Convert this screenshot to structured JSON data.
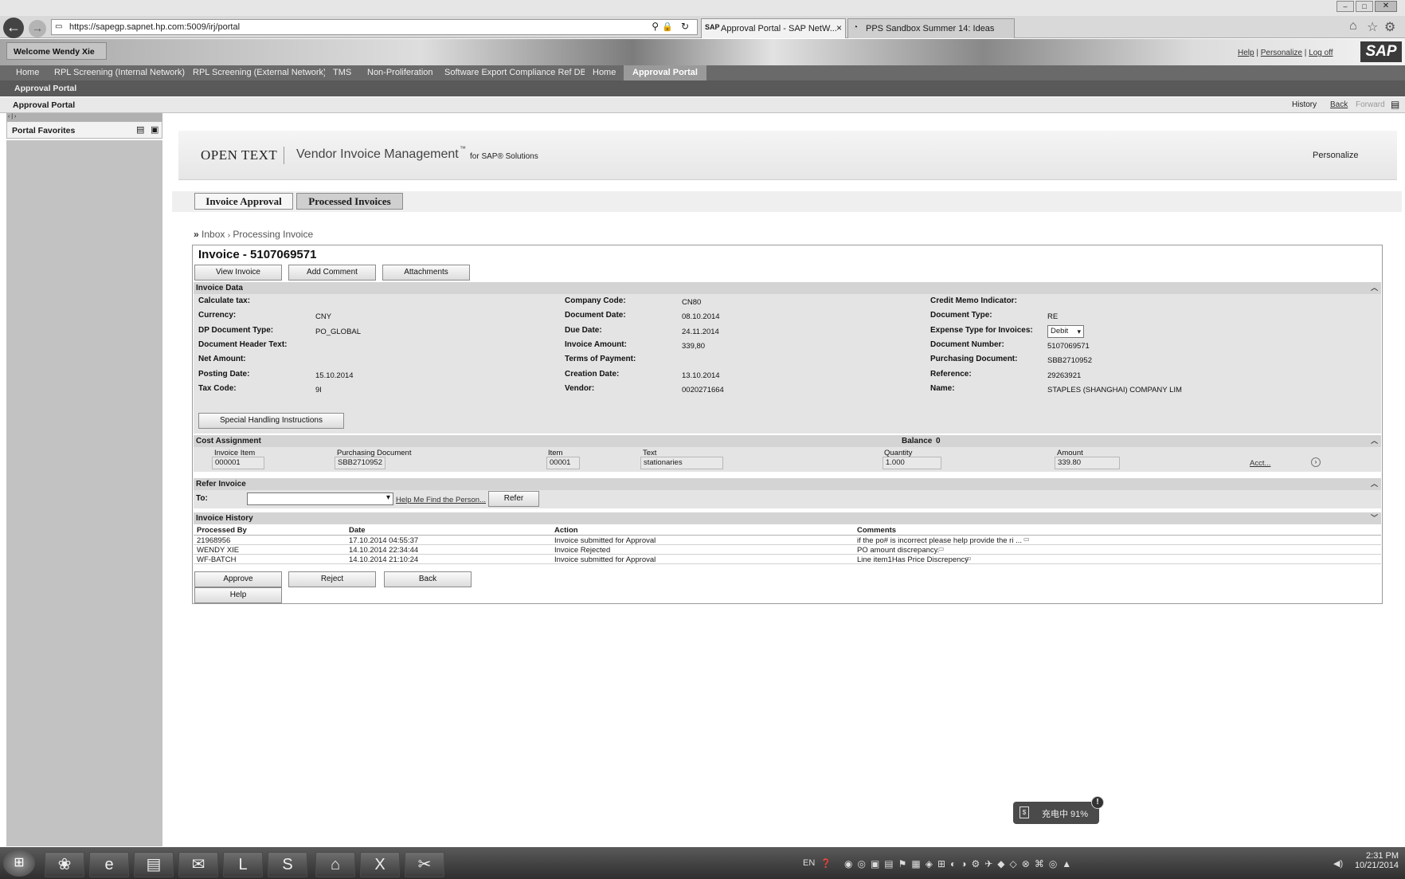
{
  "browser": {
    "url": "https://sapegp.sapnet.hp.com:5009/irj/portal",
    "tabs": [
      {
        "label": "Approval Portal - SAP NetW...",
        "close": "×"
      },
      {
        "label": "PPS Sandbox Summer 14: Ideas"
      }
    ]
  },
  "portal": {
    "welcome": "Welcome Wendy Xie",
    "header_links": [
      "Help",
      "Personalize",
      "Log off"
    ],
    "logo": "SAP",
    "nav_tabs": [
      "Home",
      "RPL Screening (Internal Network)",
      "RPL Screening (External Network)",
      "TMS",
      "Non-Proliferation",
      "Software Export Compliance Ref DB",
      "Home",
      "Approval Portal"
    ],
    "subnav": "Approval Portal",
    "page_title": "Approval Portal",
    "history_links": [
      "History",
      "Back",
      "Forward"
    ],
    "favorites_title": "Portal Favorites"
  },
  "vim": {
    "brand": "OPEN TEXT",
    "product": "Vendor Invoice Management",
    "tm": "™",
    "for_sap": "for SAP® Solutions",
    "personalize": "Personalize",
    "tabs": [
      "Invoice Approval",
      "Processed Invoices"
    ],
    "breadcrumb_root": "Inbox",
    "breadcrumb_sep": "›",
    "breadcrumb_current": "Processing Invoice",
    "invoice_title": "Invoice - 5107069571",
    "action_buttons": [
      "View Invoice",
      "Add Comment",
      "Attachments"
    ]
  },
  "invoice_data": {
    "title": "Invoice Data",
    "col1": [
      {
        "label": "Calculate tax:",
        "value": ""
      },
      {
        "label": "Currency:",
        "value": "CNY"
      },
      {
        "label": "DP Document Type:",
        "value": "PO_GLOBAL"
      },
      {
        "label": "Document Header Text:",
        "value": ""
      },
      {
        "label": "Net Amount:",
        "value": ""
      },
      {
        "label": "Posting Date:",
        "value": "15.10.2014"
      },
      {
        "label": "Tax Code:",
        "value": "9I"
      }
    ],
    "col2": [
      {
        "label": "Company Code:",
        "value": "CN80"
      },
      {
        "label": "Document Date:",
        "value": "08.10.2014"
      },
      {
        "label": "Due Date:",
        "value": "24.11.2014"
      },
      {
        "label": "Invoice Amount:",
        "value": "339,80"
      },
      {
        "label": "Terms of Payment:",
        "value": ""
      },
      {
        "label": "Creation Date:",
        "value": "13.10.2014"
      },
      {
        "label": "Vendor:",
        "value": "0020271664"
      }
    ],
    "col3": [
      {
        "label": "Credit Memo Indicator:",
        "value": ""
      },
      {
        "label": "Document Type:",
        "value": "RE"
      },
      {
        "label": "Expense Type for Invoices:",
        "value": "Debit"
      },
      {
        "label": "Document Number:",
        "value": "5107069571"
      },
      {
        "label": "Purchasing Document:",
        "value": "SBB2710952"
      },
      {
        "label": "Reference:",
        "value": "29263921"
      },
      {
        "label": "Name:",
        "value": "STAPLES (SHANGHAI) COMPANY LIM"
      }
    ],
    "special_button": "Special Handling Instructions"
  },
  "cost_assignment": {
    "title": "Cost Assignment",
    "balance_label": "Balance",
    "balance_value": "0",
    "headers": [
      "Invoice Item",
      "Purchasing Document",
      "Item",
      "Text",
      "Quantity",
      "Amount"
    ],
    "row": [
      "000001",
      "SBB2710952",
      "00001",
      "stationaries",
      "1.000",
      "339.80"
    ],
    "acct_link": "Acct..."
  },
  "refer": {
    "title": "Refer Invoice",
    "to_label": "To:",
    "to_value": "",
    "help_link": "Help Me Find the Person...",
    "refer_button": "Refer"
  },
  "history": {
    "title": "Invoice History",
    "headers": [
      "Processed By",
      "Date",
      "Action",
      "Comments"
    ],
    "rows": [
      [
        "21968956",
        "17.10.2014 04:55:37",
        "Invoice submitted for Approval",
        "if the po# is incorrect please help provide the ri ..."
      ],
      [
        "WENDY XIE",
        "14.10.2014 22:34:44",
        "Invoice Rejected",
        "PO amount discrepancy."
      ],
      [
        "WF-BATCH",
        "14.10.2014 21:10:24",
        "Invoice submitted for Approval",
        "Line item1Has Price Discrepency"
      ]
    ]
  },
  "bottom_buttons": [
    "Approve",
    "Reject",
    "Back",
    "Help"
  ],
  "notification": {
    "text": "充电中 91%",
    "badge": "!"
  },
  "taskbar": {
    "lang": "EN",
    "time": "2:31 PM",
    "date": "10/21/2014"
  }
}
